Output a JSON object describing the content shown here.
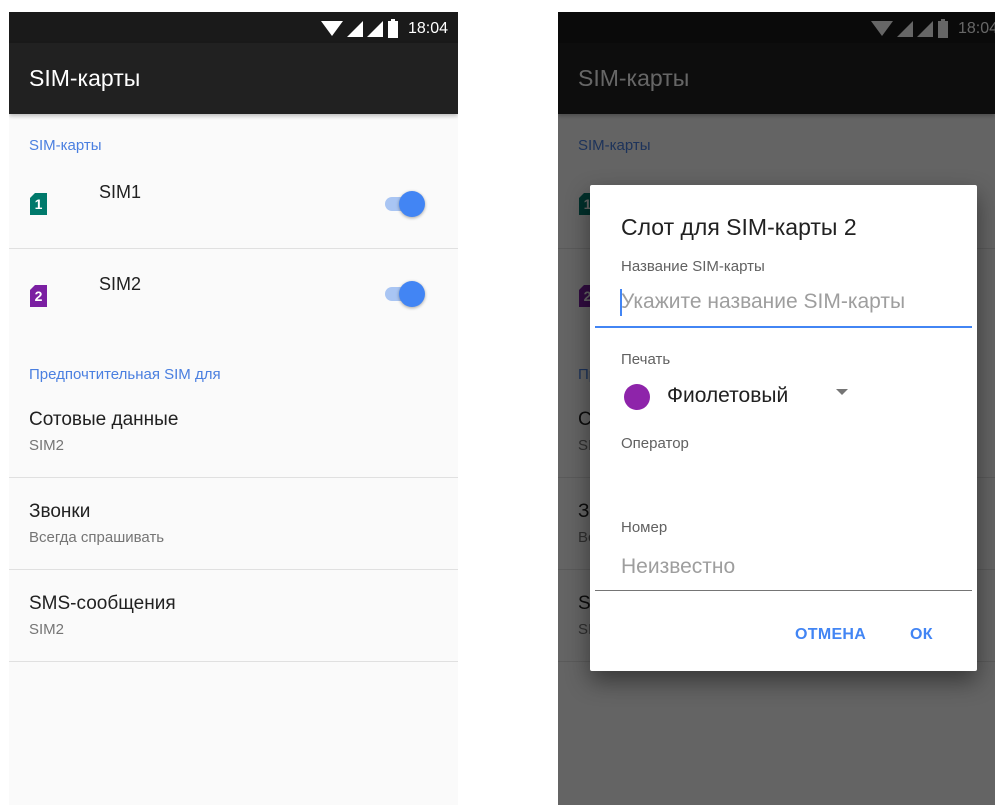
{
  "status_bar": {
    "time": "18:04"
  },
  "app_bar": {
    "title": "SIM-карты"
  },
  "sims_section": {
    "header": "SIM-карты",
    "items": [
      {
        "number": "1",
        "name": "SIM1",
        "enabled": true,
        "color": "#00796b"
      },
      {
        "number": "2",
        "name": "SIM2",
        "enabled": true,
        "color": "#7b1fa2"
      }
    ]
  },
  "preferred_section": {
    "header": "Предпочтительная SIM для",
    "items": [
      {
        "title": "Сотовые данные",
        "value": "SIM2"
      },
      {
        "title": "Звонки",
        "value": "Всегда спрашивать"
      },
      {
        "title": "SMS-сообщения",
        "value": "SIM2"
      }
    ]
  },
  "dialog": {
    "title": "Слот для SIM-карты 2",
    "name_label": "Название SIM-карты",
    "name_placeholder": "Укажите название SIM-карты",
    "name_value": "",
    "color_label": "Печать",
    "color_value": "Фиолетовый",
    "color_hex": "#8e24aa",
    "operator_label": "Оператор",
    "operator_value": "",
    "number_label": "Номер",
    "number_value": "Неизвестно",
    "cancel_label": "ОТМЕНА",
    "ok_label": "ОК"
  },
  "colors": {
    "accent": "#4285f4",
    "section_header": "#4a7fe0",
    "app_bar": "#212121",
    "status_bar": "#1a1a1a"
  }
}
